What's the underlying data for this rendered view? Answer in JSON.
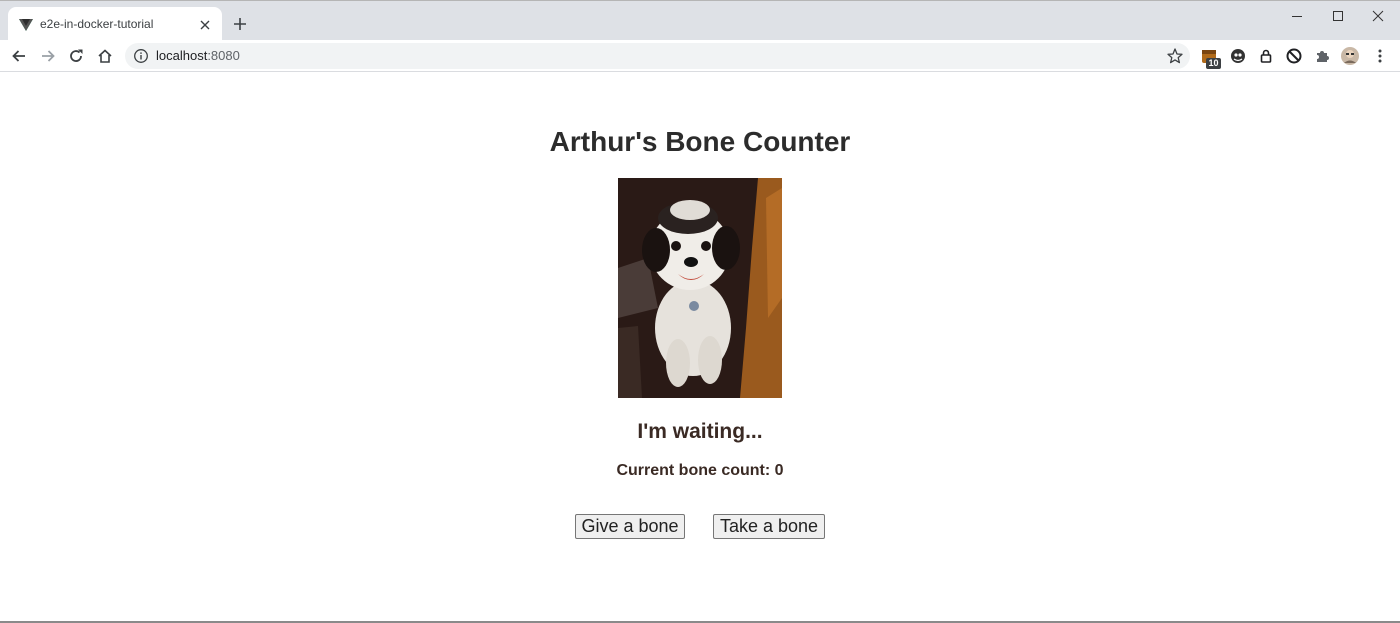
{
  "browser": {
    "tab_title": "e2e-in-docker-tutorial",
    "url_host": "localhost",
    "url_port": ":8080",
    "extension_badge": "10"
  },
  "page": {
    "title": "Arthur's Bone Counter",
    "status": "I'm waiting...",
    "count_label": "Current bone count: 0",
    "give_button": "Give a bone",
    "take_button": "Take a bone"
  }
}
